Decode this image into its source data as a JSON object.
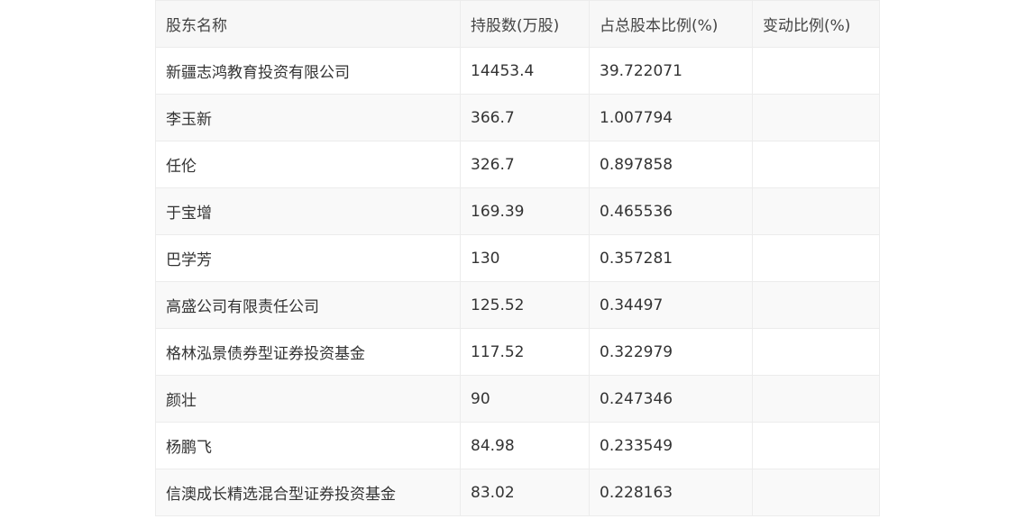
{
  "table": {
    "headers": [
      "股东名称",
      "持股数(万股)",
      "占总股本比例(%)",
      "变动比例(%)"
    ],
    "rows": [
      [
        "新疆志鸿教育投资有限公司",
        "14453.4",
        "39.722071",
        ""
      ],
      [
        "李玉新",
        "366.7",
        "1.007794",
        ""
      ],
      [
        "任伦",
        "326.7",
        "0.897858",
        ""
      ],
      [
        "于宝增",
        "169.39",
        "0.465536",
        ""
      ],
      [
        "巴学芳",
        "130",
        "0.357281",
        ""
      ],
      [
        "高盛公司有限责任公司",
        "125.52",
        "0.34497",
        ""
      ],
      [
        "格林泓景债券型证券投资基金",
        "117.52",
        "0.322979",
        ""
      ],
      [
        "颜壮",
        "90",
        "0.247346",
        ""
      ],
      [
        "杨鹏飞",
        "84.98",
        "0.233549",
        ""
      ],
      [
        "信澳成长精选混合型证券投资基金",
        "83.02",
        "0.228163",
        ""
      ]
    ]
  }
}
